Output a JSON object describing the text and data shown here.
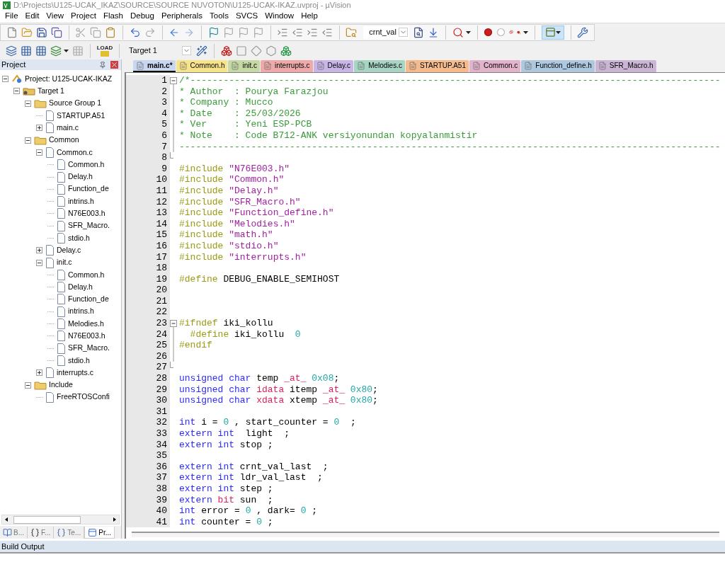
{
  "window": {
    "title": "D:\\Projects\\U125-UCAK_IKAZ\\SOURCE\\SOURCE NUVOTON\\U125-UCAK-IKAZ.uvproj - µVision"
  },
  "menu": [
    "File",
    "Edit",
    "View",
    "Project",
    "Flash",
    "Debug",
    "Peripherals",
    "Tools",
    "SVCS",
    "Window",
    "Help"
  ],
  "toolbar": {
    "find_combo": {
      "value": "crnt_val"
    },
    "target_combo": {
      "value": "Target 1"
    },
    "load_label": "LOAD"
  },
  "project_panel": {
    "title": "Project",
    "tree": [
      {
        "label": "Project: U125-UCAK-IKAZ",
        "kind": "project",
        "expanded": true,
        "children": [
          {
            "label": "Target 1",
            "kind": "target",
            "expanded": true,
            "children": [
              {
                "label": "Source Group 1",
                "kind": "folder",
                "expanded": true,
                "children": [
                  {
                    "label": "STARTUP.A51",
                    "kind": "file"
                  },
                  {
                    "label": "main.c",
                    "kind": "file",
                    "expanded": false
                  }
                ]
              },
              {
                "label": "Common",
                "kind": "folder",
                "expanded": true,
                "children": [
                  {
                    "label": "Common.c",
                    "kind": "file",
                    "expanded": true,
                    "children": [
                      {
                        "label": "Common.h",
                        "kind": "file"
                      },
                      {
                        "label": "Delay.h",
                        "kind": "file"
                      },
                      {
                        "label": "Function_de",
                        "kind": "file"
                      },
                      {
                        "label": "intrins.h",
                        "kind": "file"
                      },
                      {
                        "label": "N76E003.h",
                        "kind": "file"
                      },
                      {
                        "label": "SFR_Macro.",
                        "kind": "file"
                      },
                      {
                        "label": "stdio.h",
                        "kind": "file"
                      }
                    ]
                  },
                  {
                    "label": "Delay.c",
                    "kind": "file",
                    "expanded": false
                  },
                  {
                    "label": "init.c",
                    "kind": "file",
                    "expanded": true,
                    "children": [
                      {
                        "label": "Common.h",
                        "kind": "file"
                      },
                      {
                        "label": "Delay.h",
                        "kind": "file"
                      },
                      {
                        "label": "Function_de",
                        "kind": "file"
                      },
                      {
                        "label": "intrins.h",
                        "kind": "file"
                      },
                      {
                        "label": "Melodies.h",
                        "kind": "file"
                      },
                      {
                        "label": "N76E003.h",
                        "kind": "file"
                      },
                      {
                        "label": "SFR_Macro.",
                        "kind": "file"
                      },
                      {
                        "label": "stdio.h",
                        "kind": "file"
                      }
                    ]
                  },
                  {
                    "label": "interrupts.c",
                    "kind": "file",
                    "expanded": false
                  }
                ]
              },
              {
                "label": "Include",
                "kind": "folder",
                "expanded": true,
                "children": [
                  {
                    "label": "FreeRTOSConfi",
                    "kind": "file"
                  }
                ]
              }
            ]
          }
        ]
      }
    ],
    "bottom_tabs": [
      {
        "label": "B...",
        "kind": "books",
        "selected": false
      },
      {
        "label": "F...",
        "kind": "functions",
        "selected": false
      },
      {
        "label": "Te...",
        "kind": "templates",
        "selected": false
      },
      {
        "label": "Pr...",
        "kind": "project",
        "selected": true
      }
    ]
  },
  "editor_tabs": [
    {
      "label": "main.c*",
      "color": "#c9d6f0",
      "selected": true
    },
    {
      "label": "Common.h",
      "color": "#f7e38a",
      "selected": false
    },
    {
      "label": "init.c",
      "color": "#c6d8a4",
      "selected": false
    },
    {
      "label": "interrupts.c",
      "color": "#eeaaaa",
      "selected": false
    },
    {
      "label": "Delay.c",
      "color": "#c8b6e8",
      "selected": false
    },
    {
      "label": "Melodies.c",
      "color": "#a8d4c4",
      "selected": false
    },
    {
      "label": "STARTUP.A51",
      "color": "#f6bb8c",
      "selected": false
    },
    {
      "label": "Common.c",
      "color": "#e2b3cb",
      "selected": false
    },
    {
      "label": "Function_define.h",
      "color": "#aec8e0",
      "selected": false
    },
    {
      "label": "SFR_Macro.h",
      "color": "#cab6d4",
      "selected": false
    }
  ],
  "code": [
    {
      "n": "1",
      "kind": "fold_start",
      "tokens": [
        {
          "kind": "comment",
          "text": "/*------------------------------------------------------------------------------------------------"
        }
      ]
    },
    {
      "n": "2",
      "kind": "fold_body",
      "tokens": [
        {
          "kind": "comment",
          "text": "* Author  : Pourya Farazjou"
        }
      ]
    },
    {
      "n": "3",
      "kind": "fold_body",
      "tokens": [
        {
          "kind": "comment",
          "text": "* Company : Mucco"
        }
      ]
    },
    {
      "n": "4",
      "kind": "fold_body",
      "tokens": [
        {
          "kind": "comment",
          "text": "* Date    : 25/03/2026"
        }
      ]
    },
    {
      "n": "5",
      "kind": "fold_body",
      "tokens": [
        {
          "kind": "comment",
          "text": "* Ver     : Yeni ESP-PCB"
        }
      ]
    },
    {
      "n": "6",
      "kind": "fold_body",
      "tokens": [
        {
          "kind": "comment",
          "text": "* Note    : Code B712-ANK versiyonundan kopyalanmistir"
        }
      ]
    },
    {
      "n": "7",
      "kind": "fold_body",
      "tokens": [
        {
          "kind": "comment",
          "text": "--------------------------------------------------------------------------------------------------"
        }
      ]
    },
    {
      "n": "8",
      "kind": "fold_end"
    },
    {
      "n": "9",
      "tokens": [
        {
          "kind": "preproc",
          "text": "#include "
        },
        {
          "kind": "string",
          "text": "\"N76E003.h\""
        }
      ]
    },
    {
      "n": "10",
      "tokens": [
        {
          "kind": "preproc",
          "text": "#include "
        },
        {
          "kind": "string",
          "text": "\"Common.h\""
        }
      ]
    },
    {
      "n": "11",
      "tokens": [
        {
          "kind": "preproc",
          "text": "#include "
        },
        {
          "kind": "string",
          "text": "\"Delay.h\""
        }
      ]
    },
    {
      "n": "12",
      "tokens": [
        {
          "kind": "preproc",
          "text": "#include "
        },
        {
          "kind": "string",
          "text": "\"SFR_Macro.h\""
        }
      ]
    },
    {
      "n": "13",
      "tokens": [
        {
          "kind": "preproc",
          "text": "#include "
        },
        {
          "kind": "string",
          "text": "\"Function_define.h\""
        }
      ]
    },
    {
      "n": "14",
      "tokens": [
        {
          "kind": "preproc",
          "text": "#include "
        },
        {
          "kind": "string",
          "text": "\"Melodies.h\""
        }
      ]
    },
    {
      "n": "15",
      "tokens": [
        {
          "kind": "preproc",
          "text": "#include "
        },
        {
          "kind": "string",
          "text": "\"math.h\""
        }
      ]
    },
    {
      "n": "16",
      "tokens": [
        {
          "kind": "preproc",
          "text": "#include "
        },
        {
          "kind": "string",
          "text": "\"stdio.h\""
        }
      ]
    },
    {
      "n": "17",
      "tokens": [
        {
          "kind": "preproc",
          "text": "#include "
        },
        {
          "kind": "string",
          "text": "\"interrupts.h\""
        }
      ]
    },
    {
      "n": "18"
    },
    {
      "n": "19",
      "tokens": [
        {
          "kind": "preproc",
          "text": "#define "
        },
        {
          "kind": "plain",
          "text": "DEBUG_ENABLE_SEMIHOST"
        }
      ]
    },
    {
      "n": "20"
    },
    {
      "n": "21"
    },
    {
      "n": "22"
    },
    {
      "n": "23",
      "kind": "fold_start",
      "tokens": [
        {
          "kind": "preproc",
          "text": "#ifndef "
        },
        {
          "kind": "plain",
          "text": "iki_kollu"
        }
      ]
    },
    {
      "n": "24",
      "kind": "fold_body",
      "tokens": [
        {
          "kind": "preproc",
          "text": "  #define "
        },
        {
          "kind": "plain",
          "text": "iki_kollu  "
        },
        {
          "kind": "number",
          "text": "0"
        }
      ]
    },
    {
      "n": "25",
      "kind": "fold_body",
      "tokens": [
        {
          "kind": "preproc",
          "text": "#endif"
        }
      ]
    },
    {
      "n": "26",
      "kind": "fold_body"
    },
    {
      "n": "27",
      "kind": "fold_end"
    },
    {
      "n": "28",
      "tokens": [
        {
          "kind": "keyword",
          "text": "unsigned char "
        },
        {
          "kind": "plain",
          "text": "temp "
        },
        {
          "kind": "special",
          "text": "_at_"
        },
        {
          "kind": "number",
          "text": " 0x08"
        },
        {
          "kind": "plain",
          "text": ";"
        }
      ]
    },
    {
      "n": "29",
      "tokens": [
        {
          "kind": "keyword",
          "text": "unsigned char "
        },
        {
          "kind": "special",
          "text": "idata"
        },
        {
          "kind": "plain",
          "text": " itemp "
        },
        {
          "kind": "special",
          "text": "_at_"
        },
        {
          "kind": "number",
          "text": " 0x80"
        },
        {
          "kind": "plain",
          "text": ";"
        }
      ]
    },
    {
      "n": "30",
      "tokens": [
        {
          "kind": "keyword",
          "text": "unsigned char "
        },
        {
          "kind": "special",
          "text": "xdata"
        },
        {
          "kind": "plain",
          "text": " xtemp "
        },
        {
          "kind": "special",
          "text": "_at_"
        },
        {
          "kind": "number",
          "text": " 0x80"
        },
        {
          "kind": "plain",
          "text": ";"
        }
      ]
    },
    {
      "n": "31"
    },
    {
      "n": "32",
      "tokens": [
        {
          "kind": "keyword",
          "text": "int"
        },
        {
          "kind": "plain",
          "text": " i = "
        },
        {
          "kind": "number",
          "text": "0"
        },
        {
          "kind": "plain",
          "text": " , start_counter = "
        },
        {
          "kind": "number",
          "text": "0"
        },
        {
          "kind": "plain",
          "text": "  ;"
        }
      ]
    },
    {
      "n": "33",
      "tokens": [
        {
          "kind": "keyword",
          "text": "extern int"
        },
        {
          "kind": "plain",
          "text": "  light  ;"
        }
      ]
    },
    {
      "n": "34",
      "tokens": [
        {
          "kind": "keyword",
          "text": "extern int"
        },
        {
          "kind": "plain",
          "text": " stop ;"
        }
      ]
    },
    {
      "n": "35"
    },
    {
      "n": "36",
      "tokens": [
        {
          "kind": "keyword",
          "text": "extern int"
        },
        {
          "kind": "plain",
          "text": " crnt_val_last  ;"
        }
      ]
    },
    {
      "n": "37",
      "tokens": [
        {
          "kind": "keyword",
          "text": "extern int"
        },
        {
          "kind": "plain",
          "text": " ldr_val_last  ;"
        }
      ]
    },
    {
      "n": "38",
      "tokens": [
        {
          "kind": "keyword",
          "text": "extern int"
        },
        {
          "kind": "plain",
          "text": " step ;"
        }
      ]
    },
    {
      "n": "39",
      "tokens": [
        {
          "kind": "keyword",
          "text": "extern "
        },
        {
          "kind": "special",
          "text": "bit"
        },
        {
          "kind": "plain",
          "text": " sun  ;"
        }
      ]
    },
    {
      "n": "40",
      "tokens": [
        {
          "kind": "keyword",
          "text": "int"
        },
        {
          "kind": "plain",
          "text": " error = "
        },
        {
          "kind": "number",
          "text": "0"
        },
        {
          "kind": "plain",
          "text": " , dark= "
        },
        {
          "kind": "number",
          "text": "0"
        },
        {
          "kind": "plain",
          "text": " ;"
        }
      ]
    },
    {
      "n": "41",
      "tokens": [
        {
          "kind": "keyword",
          "text": "int"
        },
        {
          "kind": "plain",
          "text": " counter = "
        },
        {
          "kind": "number",
          "text": "0"
        },
        {
          "kind": "plain",
          "text": " ;"
        }
      ]
    }
  ],
  "output_panel": {
    "title": "Build Output"
  }
}
